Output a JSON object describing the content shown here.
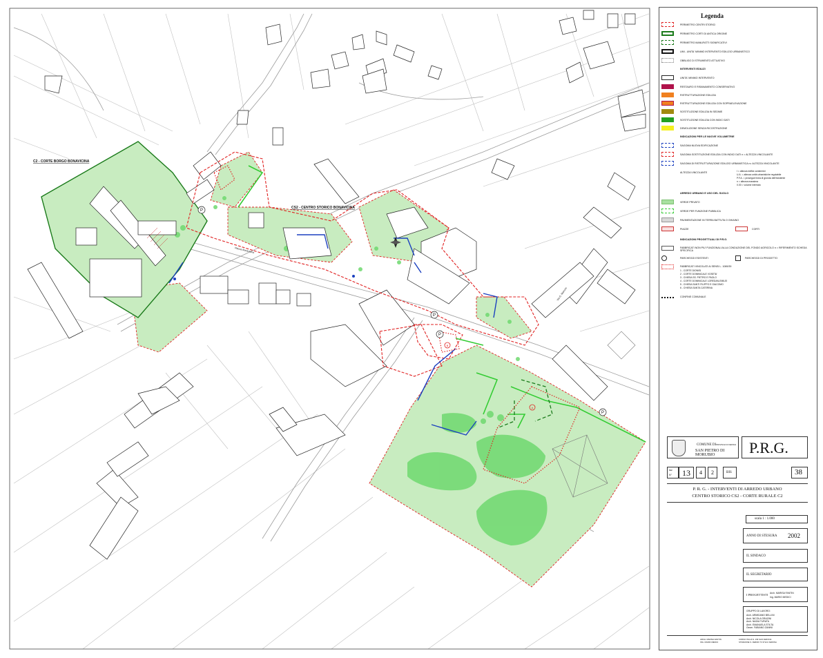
{
  "map": {
    "label_c2": "C2 - CORTE BORGO BONAVICINA",
    "label_cs2": "CS2 - CENTRO STORICO BONAVICINA",
    "street_piazza": "Piazza Bonavicina",
    "street_via": "Via G. Marconi",
    "poi_a": "A",
    "poi_b": "B",
    "parking_mark": "P",
    "colors": {
      "verde_privato": "#a8e0a0",
      "verde_pubblico": "#33cc33",
      "perimeter_red": "#e02020",
      "corti_green": "#1a7a1a",
      "blue": "#1a3fbf"
    }
  },
  "legend": {
    "title": "Legenda",
    "items1": [
      "PERIMETRO CENTRI STORICI",
      "PERIMETRO CORTI DI ANTICA ORIGINE",
      "PERIMETRO MANUFATTI SIGNIFICATIVI",
      "UMI - UNITA' MINIMO INTERVENTO EDILIZIO URBANISTICO",
      "OBBLIGO DI STRUMENTO ATTUATIVO"
    ],
    "head_interventi": "INTERVENTI EDILIZI",
    "items2": [
      "UNITA' MINIMO INTERVENTO",
      "RESTAURO E RISANAMENTO CONSERVATIVO",
      "RISTRUTTURAZIONE EDILIZIA",
      "RISTRUTTURAZIONE EDILIZIA CON SOPRAELEVAZIONE",
      "SOSTITUZIONE EDILIZIA IN SEDIME",
      "SOSTITUZIONE EDILIZIA CON INDICI DATI",
      "DEMOLIZIONE SENZA RICOSTRUZIONE"
    ],
    "head_volumetrie": "INDICAZIONI PER LE NUOVE VOLUMETRIE",
    "items3": [
      "SAGOMA NUOVA EDIFICAZIONE",
      "SAGOMA SOSTITUZIONE EDILIZIA CON INDICI DATI n = ALTEZZA VINCOLANTE",
      "SAGOMA DI RISTRUTTURAZIONE EDILIZIO URBANISTICA n= ALTEZZA VINCOLANTE",
      "ALTEZZA VINCOLANTE"
    ],
    "altezza_notes": [
      "I    = altezza edifici contermini",
      "U.A. = altezza unità urbanistiche regolabile",
      "P.F.A. = prosegue linea di gronda dell'esistente",
      "n    = altezza massima",
      "0.00 = volume interrato"
    ],
    "head_arredo": "ARREDO URBANO E USO DEL SUOLO",
    "items4": [
      "VERDE PRIVATO",
      "VERDE PER FUNZIONE PUBBLICA",
      "PAVIMENTAZIONE IN TERRA BATTUTA O GHIAINO",
      "PIAZZE"
    ],
    "corti": "CORTI",
    "head_indicazioni": "INDICAZIONI PROGETTUALI DI P.R.G.",
    "fabbricati_non": "FABBRICATI NON PIU' FUNZIONALI ALLA CONDUZIONE DEL FONDO AGRICOLO  n = RIFERIMENTO SCHEDA SPECIFICA",
    "parcheggi_esistenti": "PARCHEGGI ESISTENTI",
    "parcheggi_progetto": "PARCHEGGI DI PROGETTO",
    "fabbricati_vincolati": "FABBRICATI VINCOLATI AI SENSI L. 1089/39",
    "vincolati_list": [
      "1 - CORTE DIONISI",
      "2 - CORTE DOMINICALE VOSETA'",
      "3 - CHIESA SS. PIETRO E PAOLO",
      "4 - CORTE DOMINICALE LOREDAN-EMILEI",
      "5 - CHIESA SANTI FILIPPO E GIACOMO",
      "6 - CHIESA SANTA CATERINA"
    ],
    "confine": "CONFINE COMUNALE"
  },
  "title_block": {
    "comune_label": "COMUNE DI",
    "provincia": "PROVINCIA DI VERONA",
    "comune_name": "SAN PIETRO DI MORUBIO",
    "prg": "P.R.G.",
    "tav_label": "tav.",
    "n_label": "N°",
    "tav_num": "13",
    "tav_a": "4",
    "tav_b": "2",
    "bis": "BIS",
    "sheet": "38",
    "subtitle1": "P. R. G.  -  INTERVENTI DI ARREDO URBANO",
    "subtitle2": "CENTRO STORICO CS2 - CORTE RURALE C2",
    "scale": "scala   1 : 1.000",
    "anno_label": "ANNO DI STESURA",
    "anno": "2002",
    "sindaco": "IL SINDACO",
    "segretario": "IL SEGRETARIO",
    "progettisti_label": "I PROGETTISTI",
    "progettisti": [
      "Arch.  MARISA FANTIN",
      "Ing.   MARIO MEDICI"
    ],
    "gruppo_label": "GRUPPO DI LAVORO:",
    "gruppo": [
      "Arch.   ARMIDANO BELLINI",
      "Arch.   NICOLA GRAZINI",
      "Arch.   NADIA TURATA",
      "Arch.   EMANUELA STILTA",
      "Geom.   FABIANO ZANINI"
    ],
    "footer_l1": "ARCH. MARISA FANTIN",
    "footer_l2": "ING. MARIO MEDICI",
    "footer_m1": "CORSO ITALIA N. 139    SAN VERONA",
    "footer_m2": "STRADONE S. FERMO 73   37121 VERONA"
  }
}
